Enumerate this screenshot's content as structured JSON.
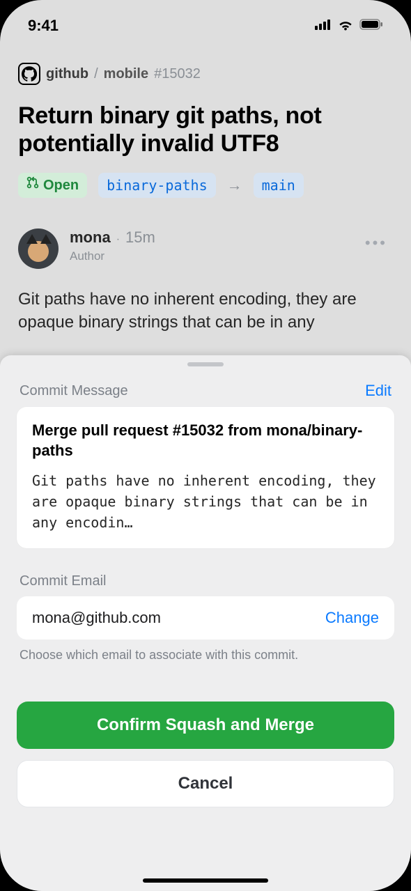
{
  "status": {
    "time": "9:41"
  },
  "breadcrumb": {
    "org": "github",
    "sep": "/",
    "repo": "mobile",
    "issue": "#15032"
  },
  "pr": {
    "title": "Return binary git paths, not potentially invalid UTF8",
    "state": "Open",
    "source_branch": "binary-paths",
    "target_branch": "main"
  },
  "comment": {
    "user": "mona",
    "time": "15m",
    "role": "Author",
    "body": "Git paths have no inherent encoding, they are opaque binary strings that can be in any"
  },
  "sheet": {
    "commit_message_label": "Commit Message",
    "edit_label": "Edit",
    "commit_title": "Merge pull request #15032 from mona/binary-paths",
    "commit_body": "Git paths have no inherent encoding, they are opaque binary strings that can be in any encodin…",
    "commit_email_label": "Commit Email",
    "email": "mona@github.com",
    "change_label": "Change",
    "email_help": "Choose which email to associate with this commit.",
    "confirm_label": "Confirm Squash and Merge",
    "cancel_label": "Cancel"
  }
}
